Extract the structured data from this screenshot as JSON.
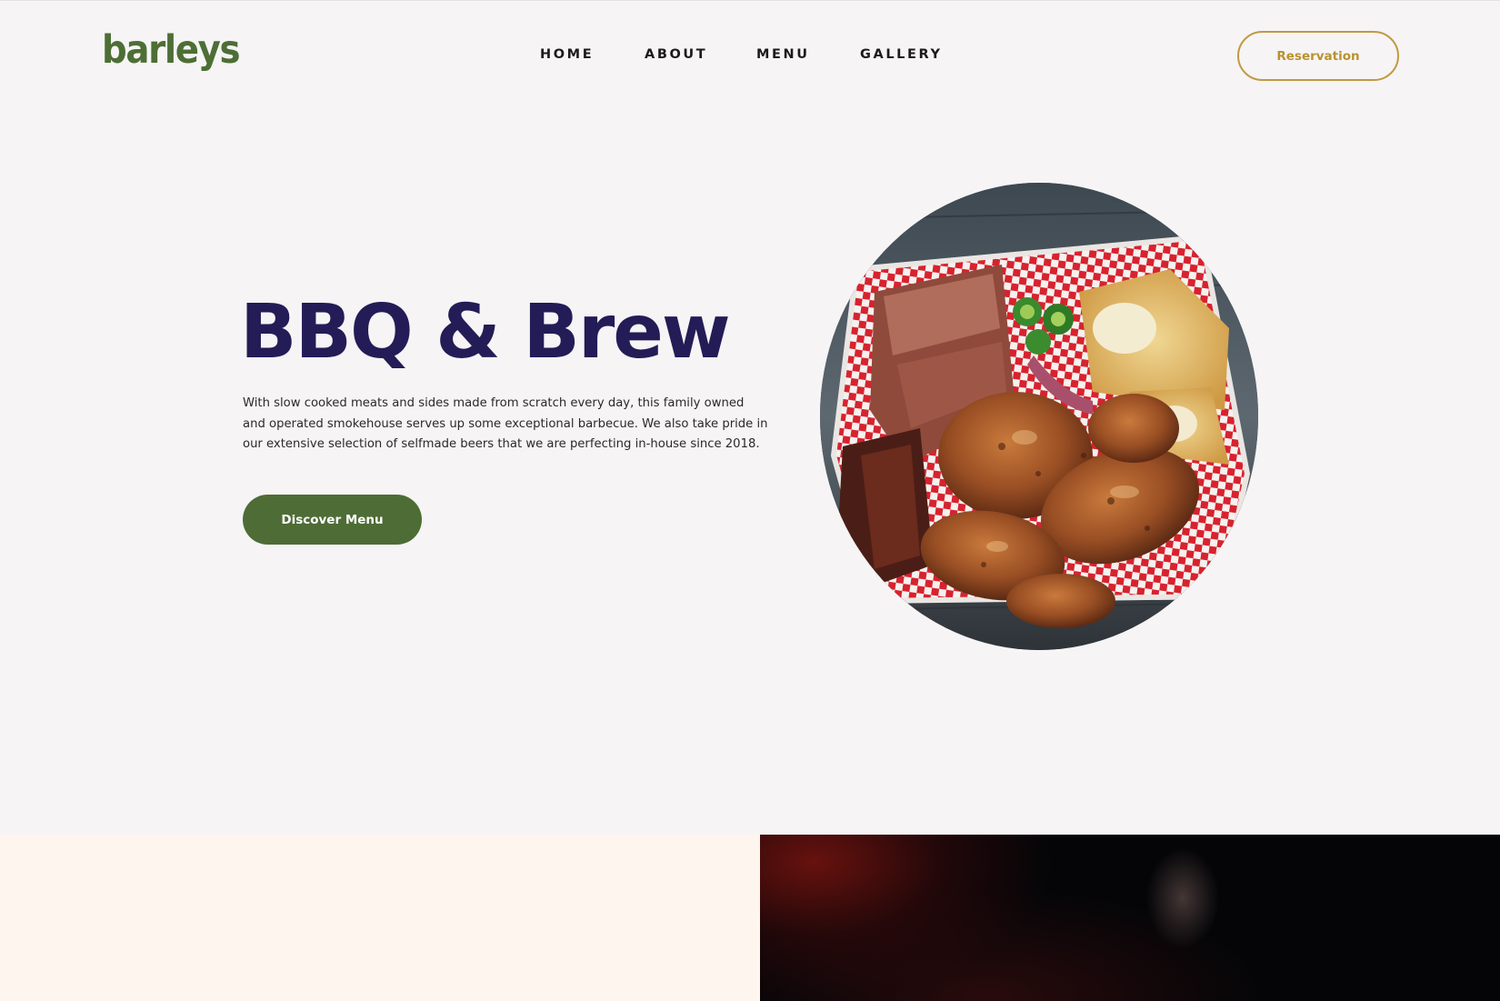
{
  "brand": {
    "logo_text": "barleys",
    "colors": {
      "logo_green": "#4d6e35",
      "title_navy": "#231c56",
      "reservation_gold": "#b8922e",
      "discover_green": "#4e6c35",
      "page_background": "#f6f4f5",
      "section_cream": "#fdf5ee"
    }
  },
  "nav": {
    "items": [
      {
        "label": "HOME"
      },
      {
        "label": "ABOUT"
      },
      {
        "label": "MENU"
      },
      {
        "label": "GALLERY"
      }
    ]
  },
  "header": {
    "reservation_label": "Reservation"
  },
  "hero": {
    "title": "BBQ & Brew",
    "description": "With slow cooked meats and sides made from scratch every day, this family owned and operated smokehouse serves up some exceptional barbecue. We also take pride in our extensive selection of selfmade beers that we are perfecting in-house since 2018.",
    "cta_label": "Discover Menu",
    "image_subject": "bbq-platter-photo"
  }
}
